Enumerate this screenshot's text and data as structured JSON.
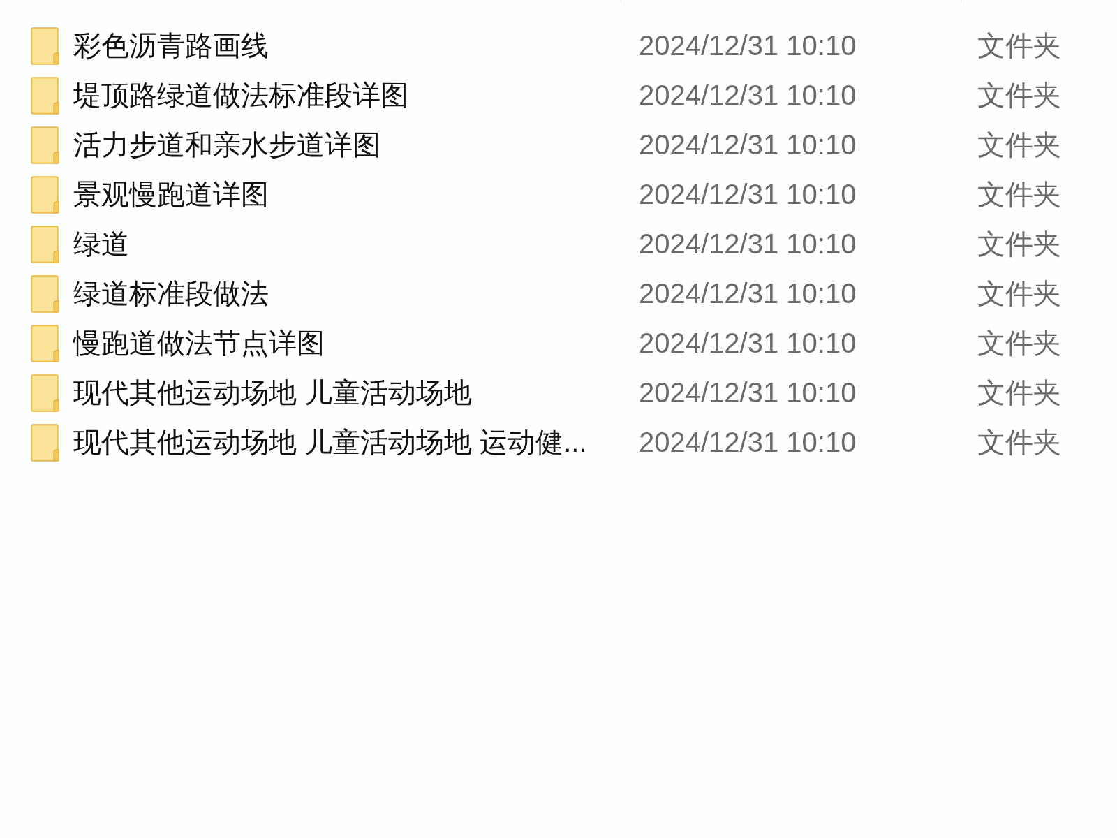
{
  "columns": [
    {
      "kind": "divider"
    },
    {
      "kind": "divider"
    }
  ],
  "rows": [
    {
      "name": "彩色沥青路画线",
      "modified": "2024/12/31 10:10",
      "type": "文件夹"
    },
    {
      "name": "堤顶路绿道做法标准段详图",
      "modified": "2024/12/31 10:10",
      "type": "文件夹"
    },
    {
      "name": "活力步道和亲水步道详图",
      "modified": "2024/12/31 10:10",
      "type": "文件夹"
    },
    {
      "name": "景观慢跑道详图",
      "modified": "2024/12/31 10:10",
      "type": "文件夹"
    },
    {
      "name": "绿道",
      "modified": "2024/12/31 10:10",
      "type": "文件夹"
    },
    {
      "name": "绿道标准段做法",
      "modified": "2024/12/31 10:10",
      "type": "文件夹"
    },
    {
      "name": "慢跑道做法节点详图",
      "modified": "2024/12/31 10:10",
      "type": "文件夹"
    },
    {
      "name": "现代其他运动场地 儿童活动场地",
      "modified": "2024/12/31 10:10",
      "type": "文件夹"
    },
    {
      "name": "现代其他运动场地 儿童活动场地 运动健...",
      "modified": "2024/12/31 10:10",
      "type": "文件夹"
    }
  ]
}
